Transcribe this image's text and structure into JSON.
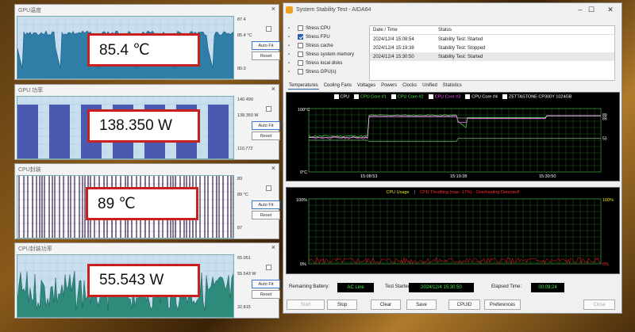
{
  "monitors": [
    {
      "title": "GPU温度",
      "max": "87.4",
      "mid": "85.4 °C",
      "min": "80.0",
      "overlay": "85.4 ℃",
      "autofit": "Auto Fit",
      "reset": "Reset",
      "level": 0.8
    },
    {
      "title": "GPU 功率",
      "max": "140.499",
      "mid": "138.350 W",
      "min": "110.772",
      "overlay": "138.350 W",
      "autofit": "Auto Fit",
      "reset": "Reset",
      "level": 0.9
    },
    {
      "title": "CPU封装",
      "max": "89",
      "mid": "89 °C",
      "min": "87",
      "overlay": "89 ℃",
      "autofit": "Auto Fit",
      "reset": "Reset",
      "level": 0.85
    },
    {
      "title": "CPU封装功率",
      "max": "65.051",
      "mid": "55.543 W",
      "min": "32.815",
      "overlay": "55.543 W",
      "autofit": "Auto Fit",
      "reset": "Reset",
      "level": 0.6
    }
  ],
  "window": {
    "title": "System Stability Test - AIDA64",
    "stress_items": [
      {
        "label": "Stress CPU",
        "checked": false
      },
      {
        "label": "Stress FPU",
        "checked": true
      },
      {
        "label": "Stress cache",
        "checked": false
      },
      {
        "label": "Stress system memory",
        "checked": false
      },
      {
        "label": "Stress local disks",
        "checked": false
      },
      {
        "label": "Stress GPU(s)",
        "checked": false
      }
    ],
    "log_headers": [
      "Date / Time",
      "Status"
    ],
    "log_rows": [
      [
        "2024/12/4 15:08:54",
        "Stability Test: Started"
      ],
      [
        "2024/12/4 15:19:38",
        "Stability Test: Stopped"
      ],
      [
        "2024/12/4 15:30:50",
        "Stability Test: Started"
      ]
    ],
    "tabs": [
      "Temperatures",
      "Cooling Fans",
      "Voltages",
      "Powers",
      "Clocks",
      "Unified",
      "Statistics"
    ],
    "temp_chart": {
      "legend": [
        {
          "label": "CPU",
          "color": "#ffffff"
        },
        {
          "label": "CPU Core #1",
          "color": "#4aea4a"
        },
        {
          "label": "CPU Core #2",
          "color": "#4aea4a"
        },
        {
          "label": "CPU Core #3",
          "color": "#ff55ff"
        },
        {
          "label": "CPU Core #4",
          "color": "#ffffff"
        },
        {
          "label": "ZETTASTONE CP300Y 1024GB",
          "color": "#ffffff"
        }
      ],
      "ymax": "100°C",
      "ymin": "0°C",
      "xticks": [
        "15:08:53",
        "15:19:38",
        "15:30:50"
      ],
      "right_labels": [
        "89",
        "89",
        "53"
      ]
    },
    "usage_chart": {
      "title": "CPU Usage",
      "sep": "|",
      "throttle": "CPU Throttling (max: 17%) - Overheating Detected!",
      "ymax": "100%",
      "ymin": "0%",
      "rmax": "100%",
      "rmin": "0%"
    },
    "battery_label": "Remaining Battery:",
    "battery_value": "AC Line",
    "started_label": "Test Started:",
    "started_value": "2024/12/4 15:30:50",
    "elapsed_label": "Elapsed Time:",
    "elapsed_value": "00:09:24",
    "buttons": [
      "Start",
      "Stop",
      "Clear",
      "Save",
      "CPUID",
      "Preferences",
      "Close"
    ]
  }
}
